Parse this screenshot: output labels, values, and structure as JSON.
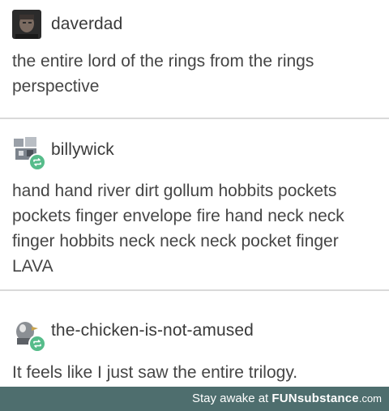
{
  "posts": [
    {
      "username": "daverdad",
      "text": "the entire lord of the rings from the rings\nperspective"
    },
    {
      "username": "billywick",
      "text": "hand hand river dirt gollum hobbits pockets\npockets finger envelope fire hand neck neck\nfinger hobbits neck neck neck pocket finger\nLAVA"
    },
    {
      "username": "the-chicken-is-not-amused",
      "text": "It feels like I just saw the entire trilogy."
    }
  ],
  "footer": {
    "prefix": "Stay awake at ",
    "brand": "FUNsubstance",
    "domain": ".com"
  },
  "colors": {
    "footer_bg": "#4e6e6e",
    "reblog_badge": "#56bc8a",
    "text": "#454545"
  }
}
